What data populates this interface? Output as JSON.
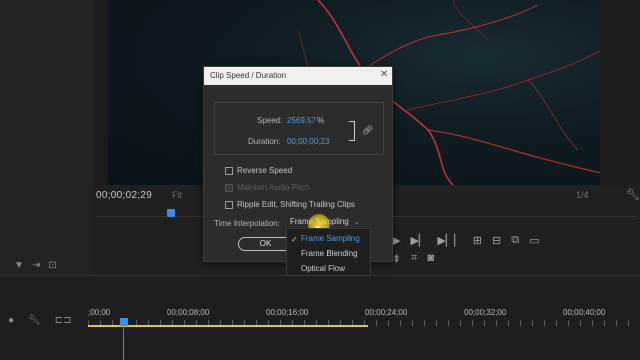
{
  "monitor": {
    "timecode": "00;00;02;29",
    "fit": "Fit",
    "resolution": "1/4"
  },
  "dialog": {
    "title": "Clip Speed / Duration",
    "speed_label": "Speed:",
    "speed_value": "2569.57",
    "speed_unit": "%",
    "duration_label": "Duration:",
    "duration_value": "00;00;00;23",
    "reverse_speed": "Reverse Speed",
    "maintain_audio": "Maintain Audio Pitch",
    "ripple_edit": "Ripple Edit, Shifting Trailing Clips",
    "time_interp_label": "Time Interpolation:",
    "time_interp_value": "Frame Sampling",
    "ok_label": "OK"
  },
  "dropdown": {
    "options": [
      "Frame Sampling",
      "Frame Blending",
      "Optical Flow"
    ],
    "selected": "Frame Sampling"
  },
  "timeline": {
    "ruler": [
      ";00;00",
      "00;00;08;00",
      "00;00;16;00",
      "00;00;24;00",
      "00;00;32;00",
      "00;00;40;00"
    ]
  },
  "colors": {
    "accent_blue": "#4e9ce6",
    "work_area": "#d9c640",
    "lava": "#e0363a"
  }
}
